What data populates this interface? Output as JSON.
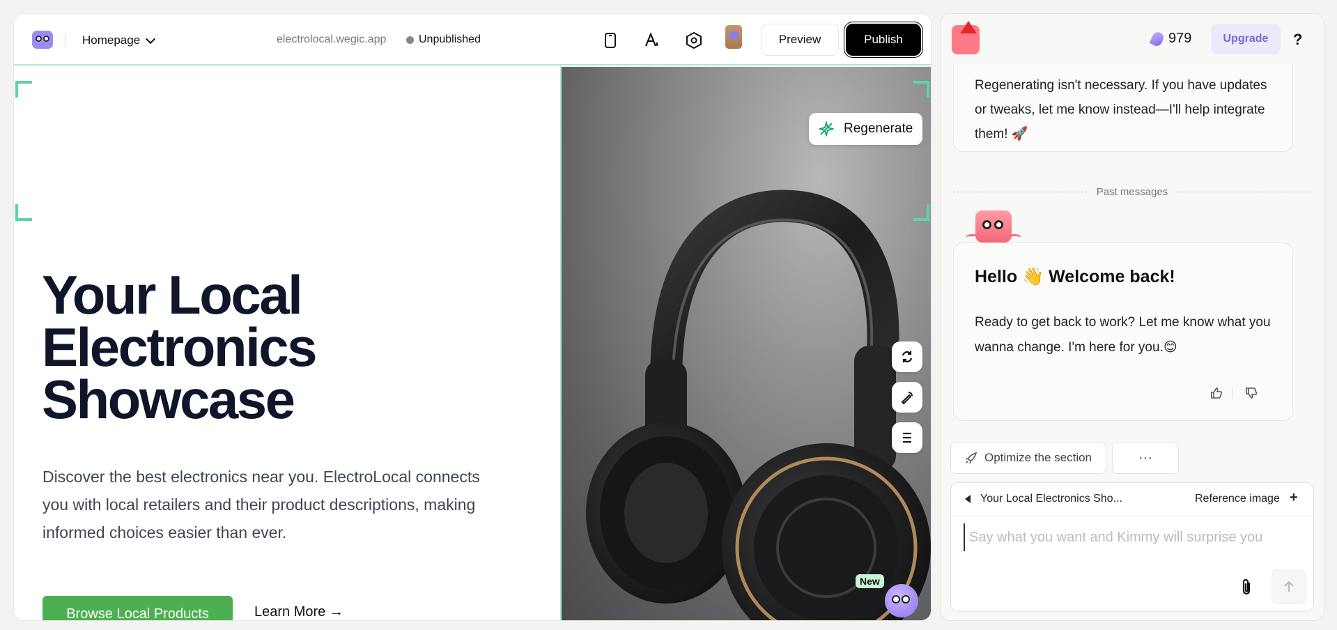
{
  "editor": {
    "page_select": "Homepage",
    "domain": "electrolocal.wegic.app",
    "status": "Unpublished",
    "preview_label": "Preview",
    "publish_label": "Publish",
    "accent": "#5ad6a3"
  },
  "hero": {
    "title": "Your Local\nElectronics\nShowcase",
    "description": "Discover the best electronics near you. ElectroLocal connects you with local retailers and their product descriptions, making informed choices easier than ever.",
    "primary_cta": "Browse Local Products",
    "secondary_cta": "Learn More →",
    "regenerate_label": "Regenerate",
    "new_badge": "New",
    "cta_color": "#4caf50"
  },
  "chat": {
    "credits": "979",
    "upgrade_label": "Upgrade",
    "help": "?",
    "prev_message": "Regenerating isn't necessary. If you have updates or tweaks, let me know instead—I'll help integrate them! 🚀",
    "past_messages_label": "Past messages",
    "greeting": "Hello 👋 Welcome back!",
    "greeting_body": "Ready to get back to work? Let me know what you wanna change. I'm here for you.😊",
    "optimize_label": "Optimize the section",
    "more_label": "···",
    "context_label": "Your Local Electronics Sho...",
    "reference_label": "Reference image",
    "add_label": "+",
    "prompt_placeholder": "Say what you want and Kimmy will surprise you"
  }
}
